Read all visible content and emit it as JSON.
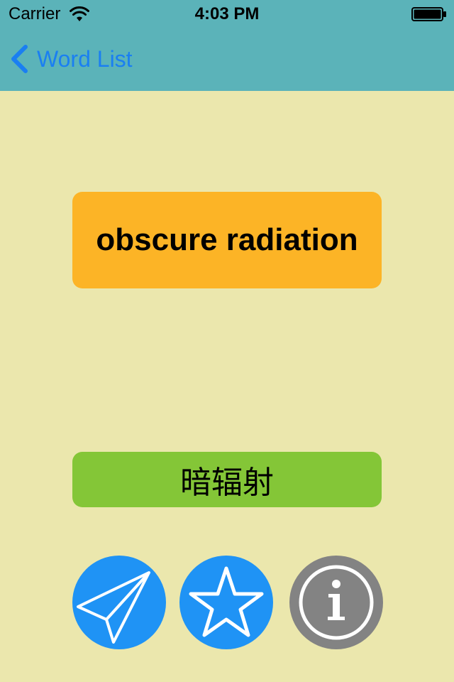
{
  "status_bar": {
    "carrier": "Carrier",
    "time": "4:03 PM",
    "wifi_icon": "wifi-icon",
    "battery_icon": "battery-icon"
  },
  "nav": {
    "back_label": "Word List",
    "back_icon": "chevron-left-icon"
  },
  "word": {
    "term": "obscure radiation",
    "translation": "暗辐射"
  },
  "actions": {
    "share_icon": "paper-plane-icon",
    "favorite_icon": "star-icon",
    "info_icon": "info-icon"
  },
  "colors": {
    "background": "#ebe7ad",
    "header": "#5bb3b9",
    "accent": "#1a7ff2",
    "word_card": "#fcb426",
    "translation_card": "#84c637",
    "action_blue": "#1f93f5",
    "action_gray": "#838383"
  }
}
